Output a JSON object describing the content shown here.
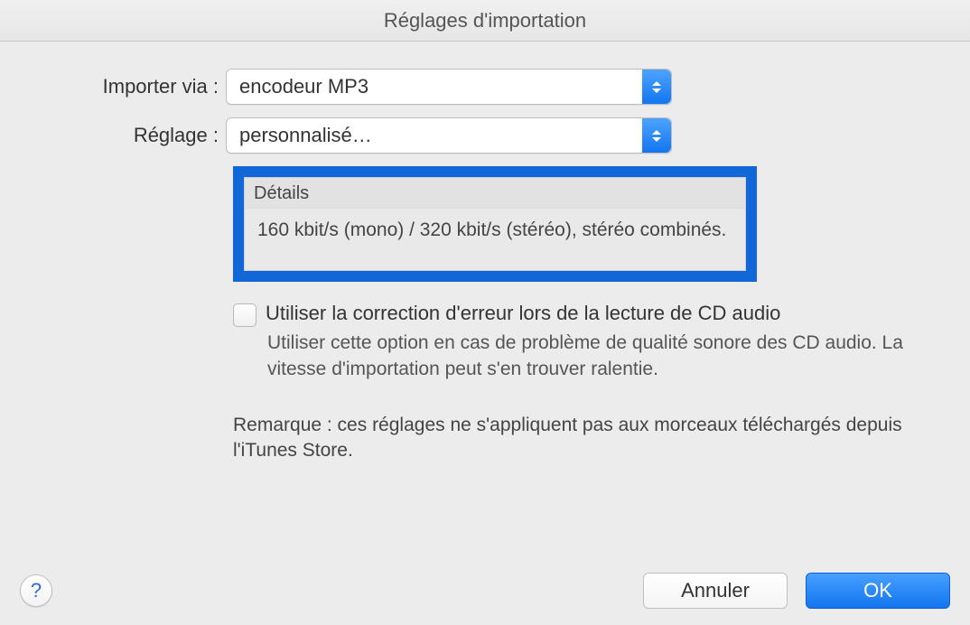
{
  "window": {
    "title": "Réglages d'importation"
  },
  "form": {
    "import_label": "Importer via :",
    "import_value": "encodeur MP3",
    "setting_label": "Réglage :",
    "setting_value": "personnalisé…"
  },
  "details": {
    "heading": "Détails",
    "body": "160 kbit/s (mono) / 320 kbit/s (stéréo), stéréo combinés."
  },
  "error_correction": {
    "label": "Utiliser la correction d'erreur lors de la lecture de CD audio",
    "description": "Utiliser cette option en cas de problème de qualité sonore des CD audio. La vitesse d'importation peut s'en trouver ralentie."
  },
  "note": "Remarque : ces réglages ne s'appliquent pas aux morceaux téléchargés depuis l'iTunes Store.",
  "buttons": {
    "help": "?",
    "cancel": "Annuler",
    "ok": "OK"
  }
}
